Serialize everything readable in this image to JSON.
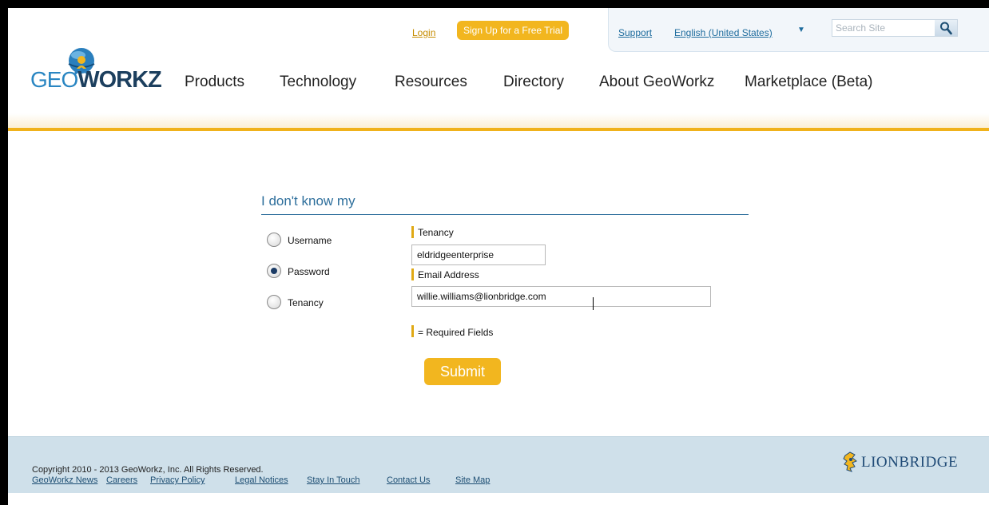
{
  "header": {
    "login_label": "Login",
    "signup_label": "Sign Up for a Free Trial",
    "support_label": "Support",
    "language_label": "English (United States)",
    "search_placeholder": "Search Site"
  },
  "logo": {
    "text_geo": "GEO",
    "text_workz": "WORKZ"
  },
  "nav": {
    "items": [
      {
        "label": "Products"
      },
      {
        "label": "Technology"
      },
      {
        "label": "Resources"
      },
      {
        "label": "Directory"
      },
      {
        "label": "About GeoWorkz"
      },
      {
        "label": "Marketplace (Beta)"
      }
    ]
  },
  "form": {
    "title": "I don't know my",
    "options": [
      {
        "label": "Username",
        "checked": false
      },
      {
        "label": "Password",
        "checked": true
      },
      {
        "label": "Tenancy",
        "checked": false
      }
    ],
    "tenancy_label": "Tenancy",
    "tenancy_value": "eldridgeenterprise",
    "email_label": "Email Address",
    "email_value": "willie.williams@lionbridge.com",
    "required_note": "= Required Fields",
    "submit_label": "Submit"
  },
  "footer": {
    "links": [
      {
        "label": "GeoWorkz News"
      },
      {
        "label": "Careers"
      },
      {
        "label": "Privacy Policy"
      },
      {
        "label": "Legal Notices"
      },
      {
        "label": "Stay In Touch"
      },
      {
        "label": "Contact Us"
      },
      {
        "label": "Site Map"
      }
    ],
    "copyright": "Copyright 2010 - 2013 GeoWorkz, Inc.  All Rights Reserved.",
    "partner_logo_text": "LIONBRIDGE"
  },
  "colors": {
    "accent": "#f2b61f",
    "link_blue": "#1d6b9d",
    "footer_bg": "#cfe0ea"
  },
  "icons": [
    "search-icon",
    "globe-icon",
    "lion-icon",
    "dropdown-caret-icon"
  ]
}
